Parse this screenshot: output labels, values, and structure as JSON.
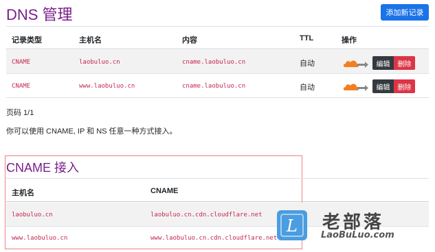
{
  "header": {
    "title": "DNS 管理",
    "add_button": "添加新记录"
  },
  "records_table": {
    "columns": [
      "记录类型",
      "主机名",
      "内容",
      "TTL",
      "操作"
    ],
    "rows": [
      {
        "type": "CNAME",
        "host": "laobuluo.cn",
        "content": "cname.laobuluo.cn",
        "ttl": "自动",
        "edit": "编辑",
        "delete": "删除"
      },
      {
        "type": "CNAME",
        "host": "www.laobuluo.cn",
        "content": "cname.laobuluo.cn",
        "ttl": "自动",
        "edit": "编辑",
        "delete": "删除"
      }
    ]
  },
  "pagination": {
    "text": "页码 1/1"
  },
  "note": {
    "text": "你可以使用 CNAME, IP 和 NS 任意一种方式接入。"
  },
  "cname_section": {
    "title": "CNAME 接入",
    "columns": [
      "主机名",
      "CNAME"
    ],
    "rows": [
      {
        "host": "laobuluo.cn",
        "cname": "laobuluo.cn.cdn.cloudflare.net"
      },
      {
        "host": "www.laobuluo.cn",
        "cname": "www.laobuluo.cn.cdn.cloudflare.net"
      }
    ]
  },
  "watermark": {
    "big": "老部落",
    "small": "LaoBuLuo.com",
    "logo_letter": "L"
  },
  "colors": {
    "title": "#7a1e8c",
    "primary": "#1a73e8",
    "danger": "#dc3545",
    "dark": "#343a40",
    "code": "#c7254e",
    "cloud": "#f38020",
    "stripe": "#f2f2f2",
    "highlight_box": "#f08080"
  }
}
